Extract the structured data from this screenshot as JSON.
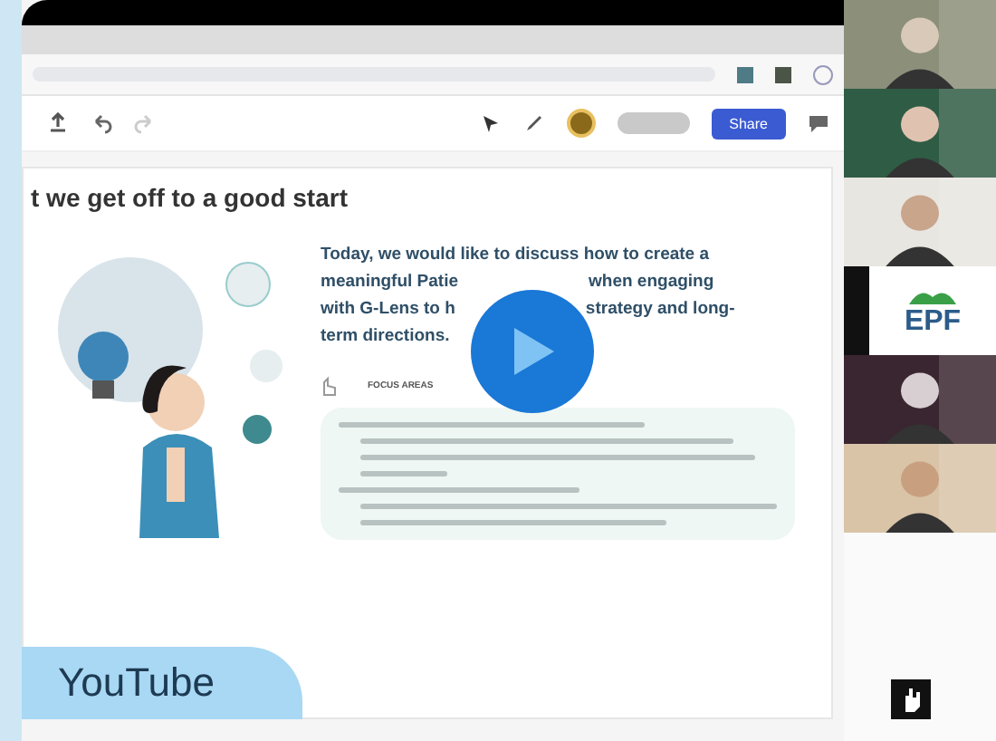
{
  "toolbar": {
    "share_button": "Share"
  },
  "slide": {
    "title": "t we get off to a good start",
    "intro_lines": [
      [
        "Today, we would like to discuss how to create a"
      ],
      [
        "meaningful Patie",
        "when engaging"
      ],
      [
        "with G-Lens to h",
        "strategy and long-"
      ],
      [
        "term directions."
      ]
    ],
    "focus_label": "FOCUS AREAS"
  },
  "participants": [
    {
      "kind": "picture"
    },
    {
      "kind": "picture"
    },
    {
      "kind": "picture"
    },
    {
      "kind": "logo",
      "text": "EPF"
    },
    {
      "kind": "picture"
    },
    {
      "kind": "picture"
    }
  ],
  "player": {
    "label": "YouTube"
  }
}
